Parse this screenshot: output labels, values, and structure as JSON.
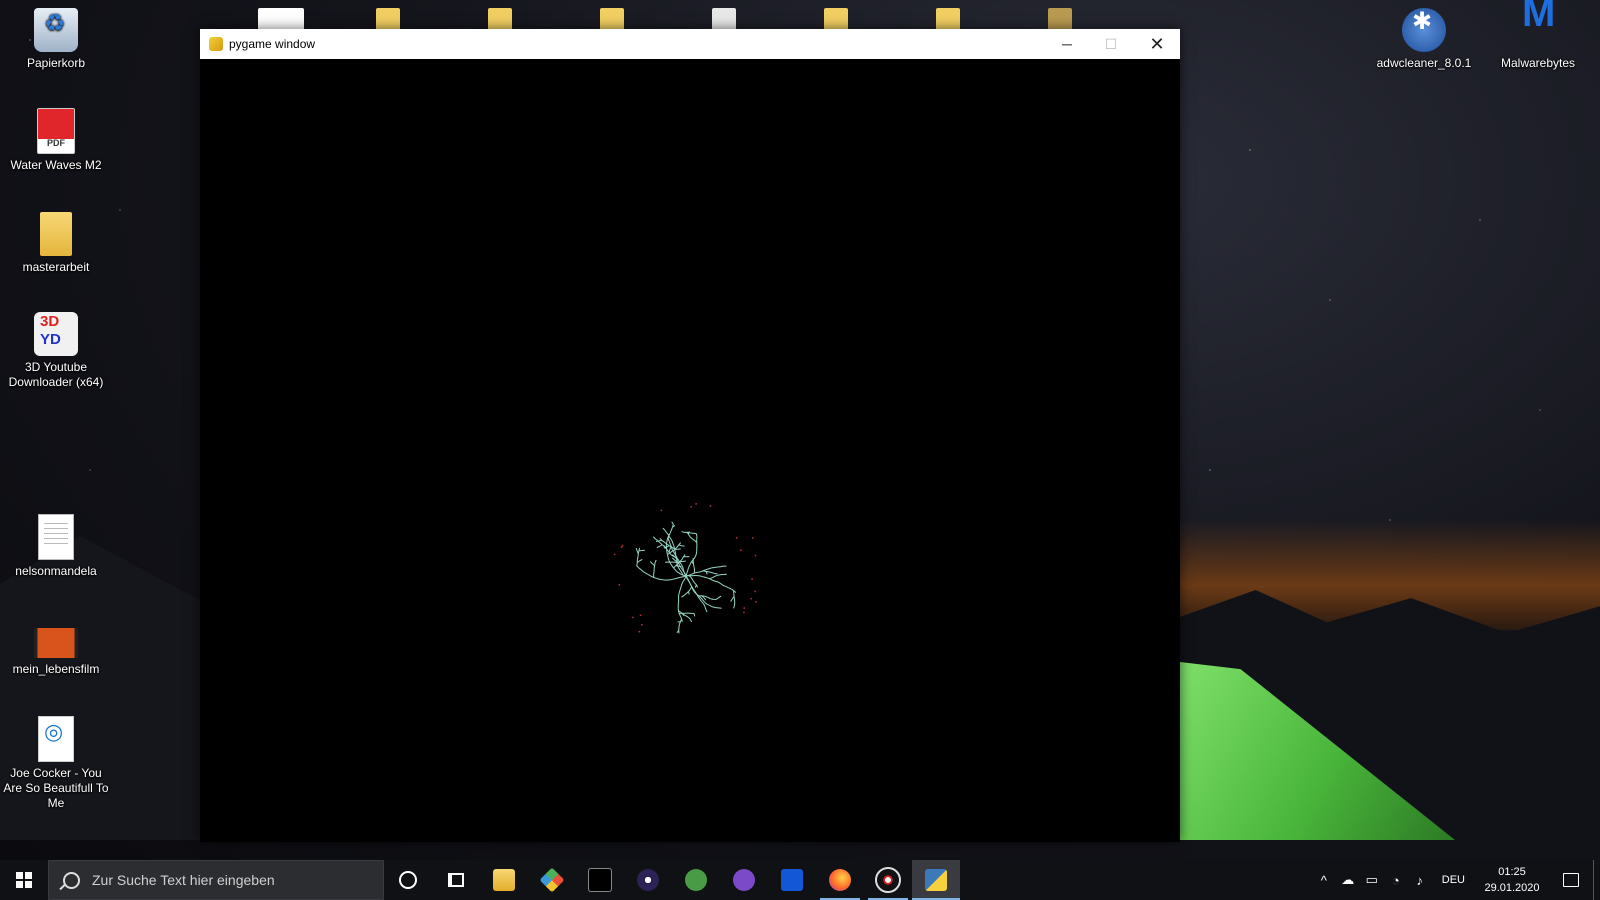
{
  "desktop": {
    "icons_left": [
      {
        "label": "Papierkorb",
        "icon": "recycle-bin-icon"
      },
      {
        "label": "Water Waves M2",
        "icon": "pdf-file-icon"
      },
      {
        "label": "masterarbeit",
        "icon": "folder-icon"
      },
      {
        "label": "3D Youtube Downloader (x64)",
        "icon": "3d-youtube-downloader-icon"
      },
      {
        "label": "nelsonmandela",
        "icon": "text-document-icon"
      },
      {
        "label": "mein_lebensfilm",
        "icon": "video-file-icon"
      },
      {
        "label": "Joe Cocker - You Are So Beautifull To Me",
        "icon": "audio-file-icon"
      }
    ],
    "icons_right": [
      {
        "label": "adwcleaner_8.0.1",
        "icon": "adwcleaner-icon"
      },
      {
        "label": "Malwarebytes",
        "icon": "malwarebytes-icon"
      }
    ]
  },
  "window": {
    "title": "pygame window",
    "icon": "pygame-snake-icon",
    "controls": {
      "minimize": "─",
      "maximize": "☐",
      "close": "✕"
    }
  },
  "taskbar": {
    "search_placeholder": "Zur Suche Text hier eingeben",
    "pinned": [
      "cortana-icon",
      "task-view-icon",
      "file-explorer-icon",
      "git-icon",
      "terminal-icon",
      "eclipse-icon",
      "android-studio-icon",
      "podcast-icon",
      "live-icon",
      "firefox-icon",
      "network-app-icon",
      "python-idle-icon"
    ],
    "tray": {
      "language": "DEU",
      "time": "01:25",
      "date": "29.01.2020"
    }
  },
  "colors": {
    "crystal": "#9ad9c8",
    "particle": "#c0303a",
    "taskbar": "#101114"
  }
}
